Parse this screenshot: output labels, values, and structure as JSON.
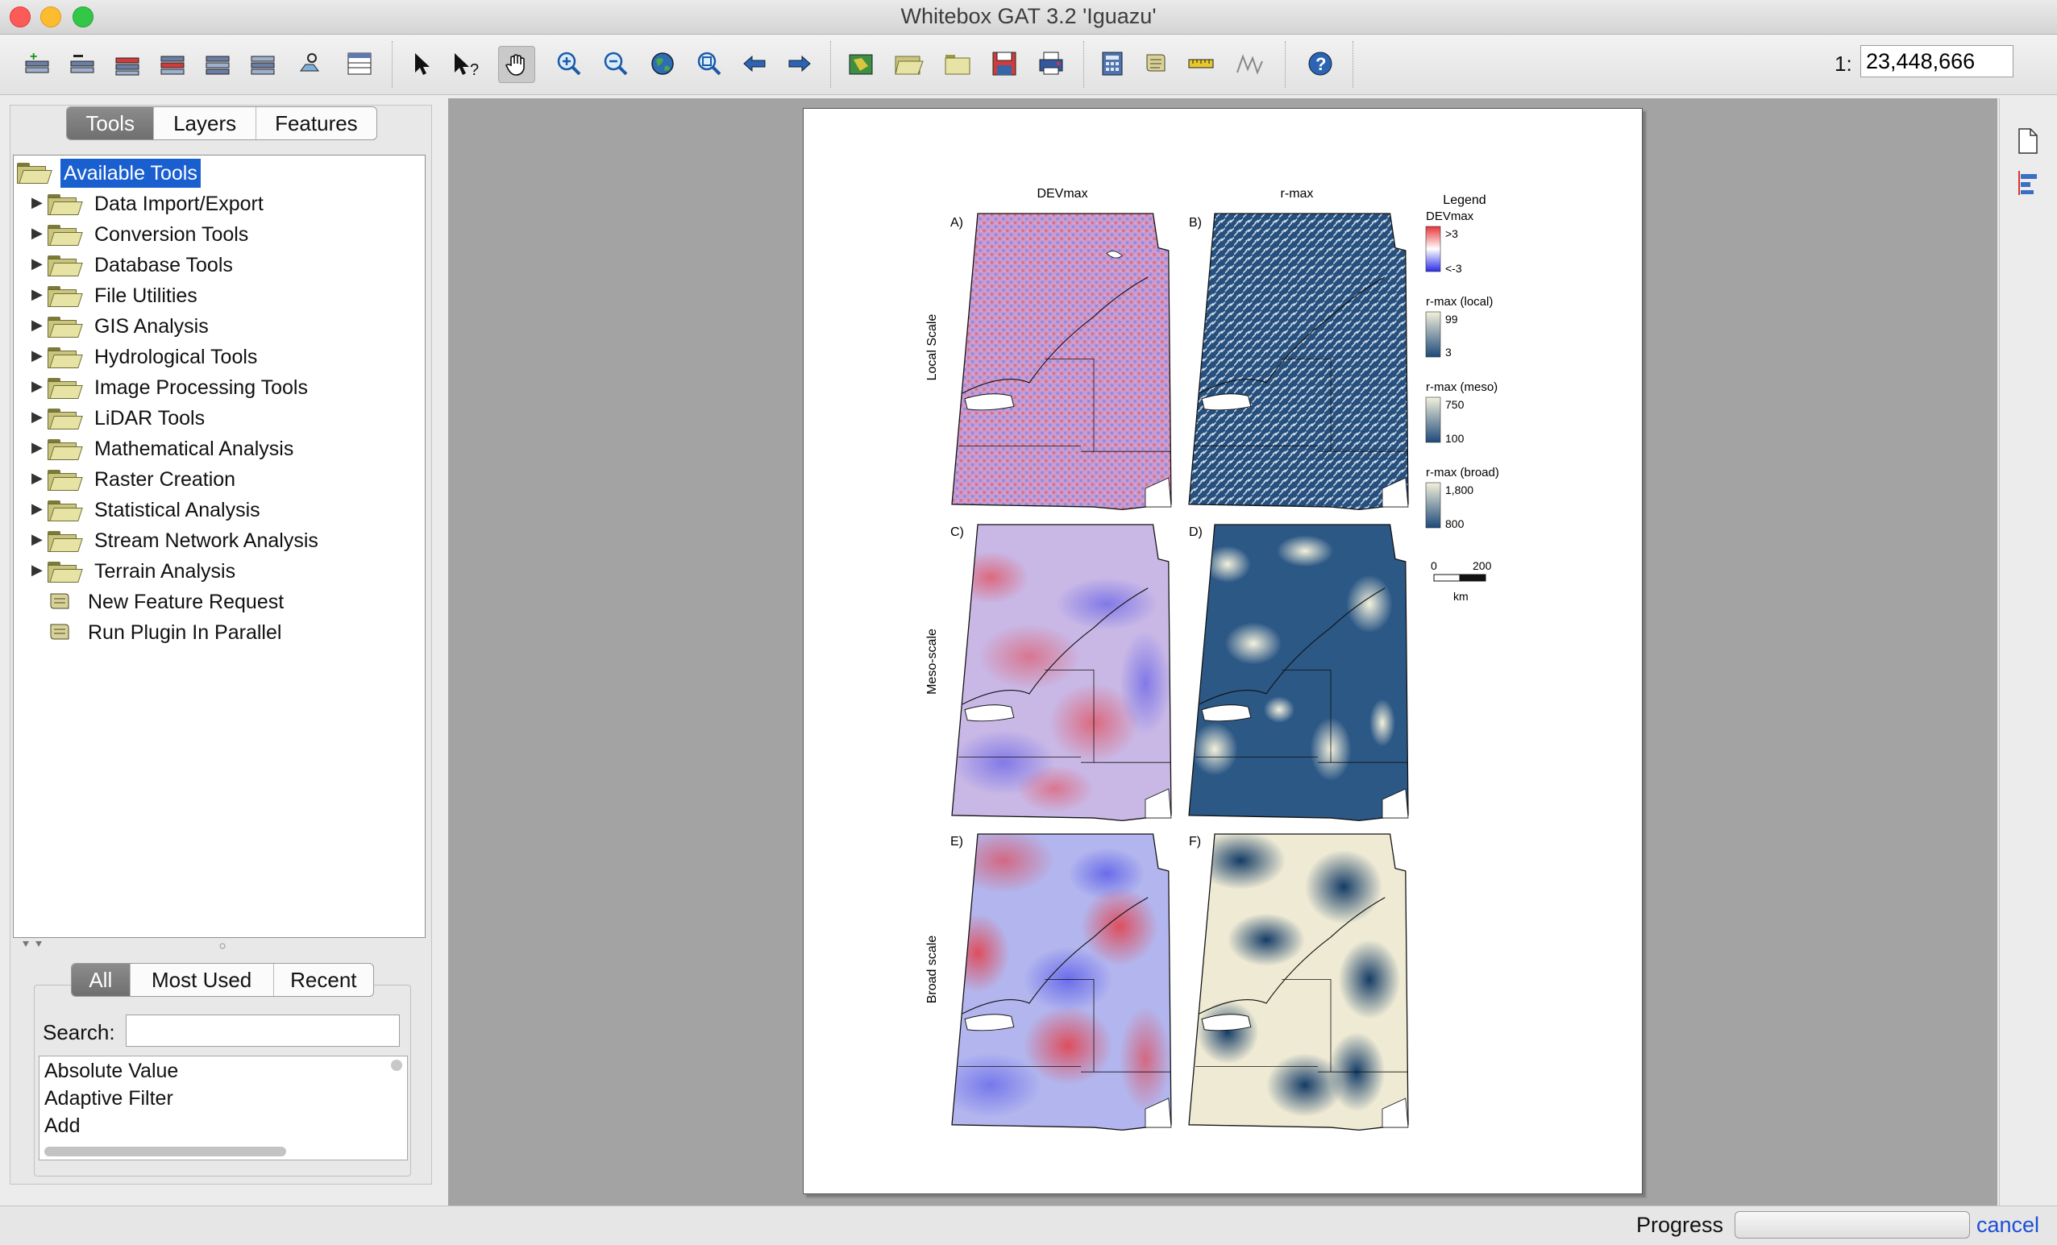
{
  "window": {
    "title": "Whitebox GAT 3.2 'Iguazu'"
  },
  "toolbar": {
    "icons": [
      "add-layer",
      "remove-layer",
      "raise-layer",
      "lower-layer",
      "layer-to-top",
      "layer-to-bottom",
      "layer-properties",
      "attribute-table",
      "select-pointer",
      "identify",
      "pan-hand",
      "zoom-in",
      "zoom-out",
      "zoom-to-full-extent",
      "zoom-to-page",
      "previous-extent",
      "next-extent",
      "new-map",
      "open-map",
      "open-folder",
      "save-map",
      "print-map",
      "calculator",
      "scripting",
      "measure-distance",
      "profile",
      "help"
    ],
    "scale_prefix": "1:",
    "scale_value": "23,448,666"
  },
  "left_panel": {
    "tabs": [
      "Tools",
      "Layers",
      "Features"
    ],
    "active_tab": "Tools",
    "tree_root": "Available Tools",
    "tree_items": [
      "Data Import/Export",
      "Conversion Tools",
      "Database Tools",
      "File Utilities",
      "GIS Analysis",
      "Hydrological Tools",
      "Image Processing Tools",
      "LiDAR Tools",
      "Mathematical Analysis",
      "Raster Creation",
      "Statistical Analysis",
      "Stream Network Analysis",
      "Terrain Analysis"
    ],
    "tree_leaf_items": [
      "New Feature Request",
      "Run Plugin In Parallel"
    ],
    "filter_tabs": [
      "All",
      "Most Used",
      "Recent"
    ],
    "active_filter_tab": "All",
    "search_label": "Search:",
    "search_value": "",
    "tool_list": [
      "Absolute Value",
      "Adaptive Filter",
      "Add"
    ]
  },
  "figure": {
    "column_titles": [
      "DEVmax",
      "r-max"
    ],
    "row_labels": [
      "Local Scale",
      "Meso-scale",
      "Broad scale"
    ],
    "panel_letters": [
      "A)",
      "B)",
      "C)",
      "D)",
      "E)",
      "F)"
    ],
    "legend": {
      "title": "Legend",
      "devmax": {
        "name": "DEVmax",
        "high": ">3",
        "low": "<-3"
      },
      "rmax_local": {
        "name": "r-max (local)",
        "high": "99",
        "low": "3"
      },
      "rmax_meso": {
        "name": "r-max (meso)",
        "high": "750",
        "low": "100"
      },
      "rmax_broad": {
        "name": "r-max (broad)",
        "high": "1,800",
        "low": "800"
      },
      "scalebar": {
        "start": "0",
        "end": "200",
        "unit": "km"
      }
    },
    "colors": {
      "devmax_high": "#e8353a",
      "devmax_low": "#2a2ae8",
      "rmax_dark": "#1d4a7a",
      "rmax_light": "#f4f1dc"
    }
  },
  "status": {
    "progress_label": "Progress",
    "cancel_label": "cancel"
  }
}
